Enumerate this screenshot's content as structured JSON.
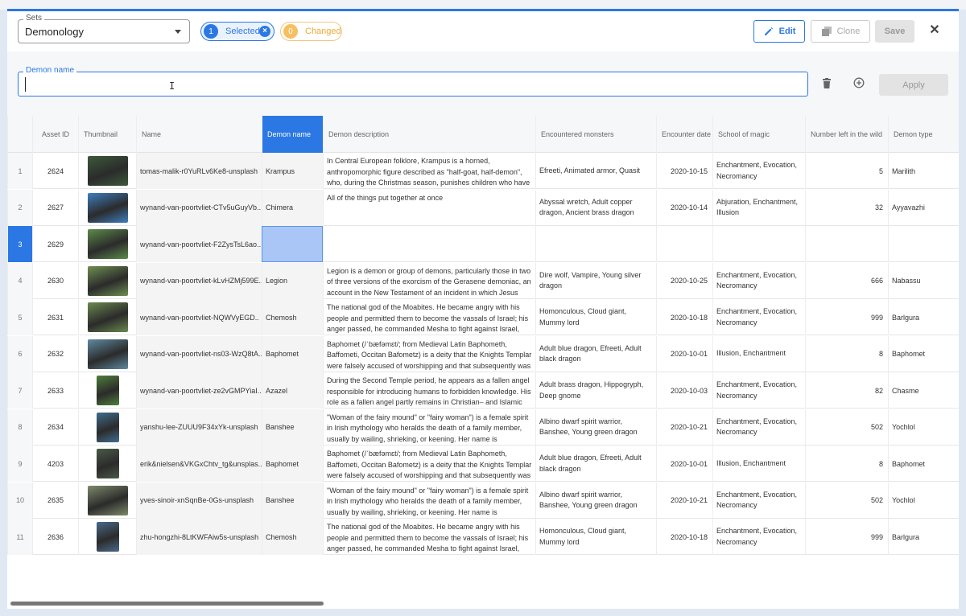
{
  "toolbar": {
    "sets_legend": "Sets",
    "sets_value": "Demonology",
    "selected_count": "1",
    "selected_label": "Selected",
    "changed_count": "0",
    "changed_label": "Changed",
    "edit_label": "Edit",
    "clone_label": "Clone",
    "save_label": "Save",
    "close_glyph": "✕"
  },
  "editor": {
    "field_legend": "Demon name",
    "field_value": "",
    "apply_label": "Apply",
    "ibeam": "I"
  },
  "colors": {
    "accent": "#2b78e4",
    "changed": "#f0a936",
    "highlight": "#a9c6f6"
  },
  "grid": {
    "columns": [
      "",
      "Asset ID",
      "Thumbnail",
      "Name",
      "Demon name",
      "Demon description",
      "Encountered monsters",
      "Encounter date",
      "School of magic",
      "Number left in the wild",
      "Demon type"
    ],
    "rows": [
      {
        "n": "1",
        "id": "2624",
        "name": "tomas-malik-r0YuRLv6Ke8-unsplash",
        "demon": "Krampus",
        "desc": "In Central European folklore, Krampus is a horned, anthropomorphic figure described as \"half-goat, half-demon\", who, during the Christmas season, punishes children who have misbehaved, in contrast with Saint Nicholas, who rewards the",
        "mon": "Efreeti, Animated armor, Quasit",
        "date": "2020-10-15",
        "school": "Enchantment, Evocation, Necromancy",
        "left": "5",
        "type": "Marilith",
        "thumb": "#3c5a3a"
      },
      {
        "n": "2",
        "id": "2627",
        "name": "wynand-van-poortvliet-CTv5uGuyVb..",
        "demon": "Chimera",
        "desc": "All of the things put together at once",
        "mon": "Abyssal wretch, Adult copper dragon, Ancient brass dragon",
        "date": "2020-10-14",
        "school": "Abjuration, Enchantment, Illusion",
        "left": "32",
        "type": "Ayyavazhi",
        "thumb": "#3d7fbf"
      },
      {
        "n": "3",
        "id": "2629",
        "name": "wynand-van-poortvliet-F2ZysTsL6ao..",
        "demon": "",
        "desc": "",
        "mon": "",
        "date": "",
        "school": "",
        "left": "",
        "type": "",
        "thumb": "#5d8c4a"
      },
      {
        "n": "4",
        "id": "2630",
        "name": "wynand-van-poortvliet-kLvHZMj599E..",
        "demon": "Legion",
        "desc": "Legion is a demon or group of demons, particularly those in two of three versions of the exorcism of the Gerasene demoniac, an account in the New Testament of an incident in which Jesus performs an exorcism.",
        "mon": "Dire wolf, Vampire, Young silver dragon",
        "date": "2020-10-25",
        "school": "Enchantment, Evocation, Necromancy",
        "left": "666",
        "type": "Nabassu",
        "thumb": "#6f8f52"
      },
      {
        "n": "5",
        "id": "2631",
        "name": "wynand-van-poortvliet-NQWVyEGD..",
        "demon": "Chemosh",
        "desc": "The national god of the Moabites. He became angry with his people and permitted them to become the vassals of Israel; his anger passed, he commanded Mesha to fight against Israel, and Moabite independence was reestablished (Moabite Stone",
        "mon": "Homonculous, Cloud giant, Mummy lord",
        "date": "2020-10-18",
        "school": "Enchantment, Evocation, Necromancy",
        "left": "999",
        "type": "Barlgura",
        "thumb": "#6a8a4e"
      },
      {
        "n": "6",
        "id": "2632",
        "name": "wynand-van-poortvliet-ns03-WzQ8tA..",
        "demon": "Baphomet",
        "desc": "Baphomet (/ˈbæfəmɛt/; from Medieval Latin Baphometh, Baffometi, Occitan Bafometz) is a deity that the Knights Templar were falsely accused of worshipping and that subsequently was incorporated into disparate occult and",
        "mon": "Adult blue dragon, Efreeti, Adult black dragon",
        "date": "2020-10-01",
        "school": "Illusion, Enchantment",
        "left": "8",
        "type": "Baphomet",
        "thumb": "#5f8aa0"
      },
      {
        "n": "7",
        "id": "2633",
        "name": "wynand-van-poortvliet-ze2vGMPYiaI..",
        "demon": "Azazel",
        "desc": "During the Second Temple period, he appears as a fallen angel responsible for introducing humans to forbidden knowledge. His role as a fallen angel partly remains in Christian– and Islamic traditions. In Islam, he is often",
        "mon": "Adult brass dragon, Hippogryph, Deep gnome",
        "date": "2020-10-03",
        "school": "Enchantment, Evocation, Necromancy",
        "left": "82",
        "type": "Chasme",
        "thumb": "#4f7f3a"
      },
      {
        "n": "8",
        "id": "2634",
        "name": "yanshu-lee-ZUUU9F34xYk-unsplash",
        "demon": "Banshee",
        "desc": "\"Woman of the fairy mound\" or \"fairy woman\") is a female spirit in Irish mythology who heralds the death of a family member, usually by wailing, shrieking, or keening. Her name is connected to the mythologically important tumuli or \"mounds\"",
        "mon": "Albino dwarf spirit warrior, Banshee, Young green dragon",
        "date": "2020-10-21",
        "school": "Enchantment, Evocation, Necromancy",
        "left": "502",
        "type": "Yochlol",
        "thumb": "#3f6e8f"
      },
      {
        "n": "9",
        "id": "4203",
        "name": "erik&nielsen&VKGxChtv_tg&unsplas..",
        "demon": "Baphomet",
        "desc": "Baphomet (/ˈbæfəmɛt/; from Medieval Latin Baphometh, Baffometi, Occitan Bafometz) is a deity that the Knights Templar were falsely accused of worshipping and that subsequently was incorporated into disparate occult and",
        "mon": "Adult blue dragon, Efreeti, Adult black dragon",
        "date": "2020-10-01",
        "school": "Illusion, Enchantment",
        "left": "8",
        "type": "Baphomet",
        "thumb": "#4a5a48"
      },
      {
        "n": "10",
        "id": "2635",
        "name": "yves-sinoir-xnSqnBe-0Gs-unsplash",
        "demon": "Banshee",
        "desc": "\"Woman of the fairy mound\" or \"fairy woman\") is a female spirit in Irish mythology who heralds the death of a family member, usually by wailing, shrieking, or keening. Her name is connected to the mythologically important tumuli or \"mounds\"",
        "mon": "Albino dwarf spirit warrior, Banshee, Young green dragon",
        "date": "2020-10-21",
        "school": "Enchantment, Evocation, Necromancy",
        "left": "502",
        "type": "Yochlol",
        "thumb": "#7e8a6a"
      },
      {
        "n": "11",
        "id": "2636",
        "name": "zhu-hongzhi-8LtKWFAiw5s-unsplash",
        "demon": "Chemosh",
        "desc": "The national god of the Moabites. He became angry with his people and permitted them to become the vassals of Israel; his anger passed, he commanded Mesha to fight against Israel, and Moabite independence was reestablished (Moabite Stone",
        "mon": "Homonculous, Cloud giant, Mummy lord",
        "date": "2020-10-18",
        "school": "Enchantment, Evocation, Necromancy",
        "left": "999",
        "type": "Barlgura",
        "thumb": "#4a6a8a"
      }
    ]
  }
}
